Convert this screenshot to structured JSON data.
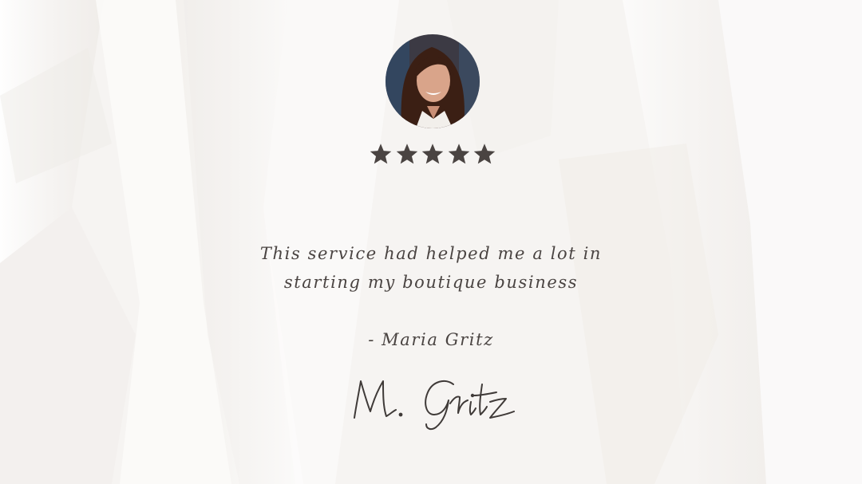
{
  "testimonial": {
    "rating": 5,
    "rating_max": 5,
    "quote_line1": "This service had helped me a lot in",
    "quote_line2": "starting my boutique business",
    "attribution": "- Maria Gritz",
    "signature": "M. Gritz"
  },
  "colors": {
    "text": "#4a4442",
    "star": "#4a4442",
    "background": "#f7f5f3"
  }
}
